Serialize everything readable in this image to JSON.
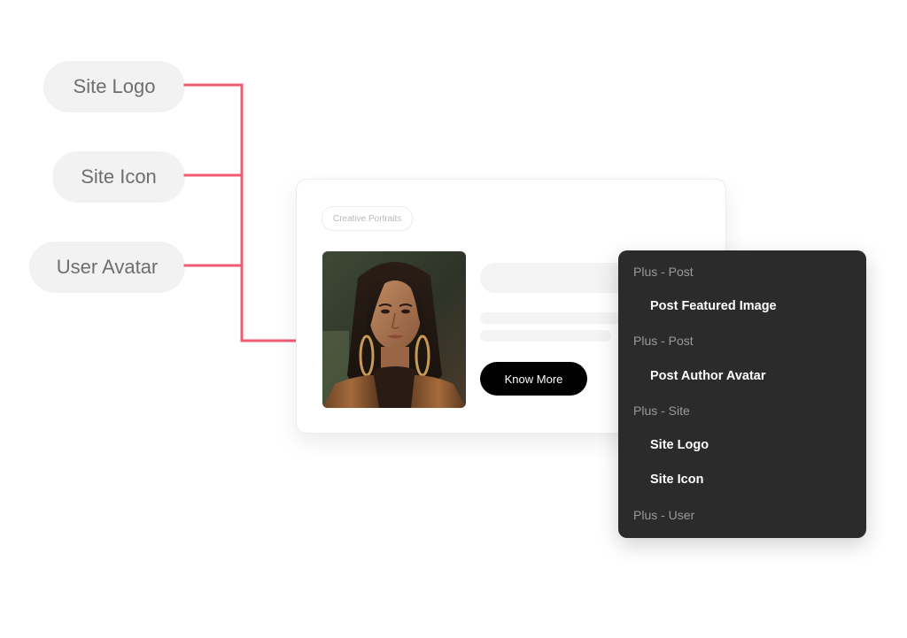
{
  "sources": [
    {
      "label": "Site Logo"
    },
    {
      "label": "Site Icon"
    },
    {
      "label": "User Avatar"
    }
  ],
  "card": {
    "tag": "Creative Portraits",
    "button_label": "Know More"
  },
  "dropdown": {
    "rows": [
      {
        "kind": "group",
        "label": "Plus - Post"
      },
      {
        "kind": "item",
        "label": "Post Featured Image"
      },
      {
        "kind": "group",
        "label": "Plus - Post"
      },
      {
        "kind": "item",
        "label": "Post Author Avatar"
      },
      {
        "kind": "group",
        "label": "Plus - Site"
      },
      {
        "kind": "item",
        "label": "Site Logo"
      },
      {
        "kind": "item",
        "label": "Site Icon"
      },
      {
        "kind": "group",
        "label": "Plus - User"
      }
    ]
  },
  "colors": {
    "connector": "#f25a72",
    "pill_bg": "#f2f2f2",
    "dropdown_bg": "#2b2b2b",
    "button_bg": "#000000"
  },
  "icons": {
    "connector_arrow": "arrow-right-icon"
  }
}
